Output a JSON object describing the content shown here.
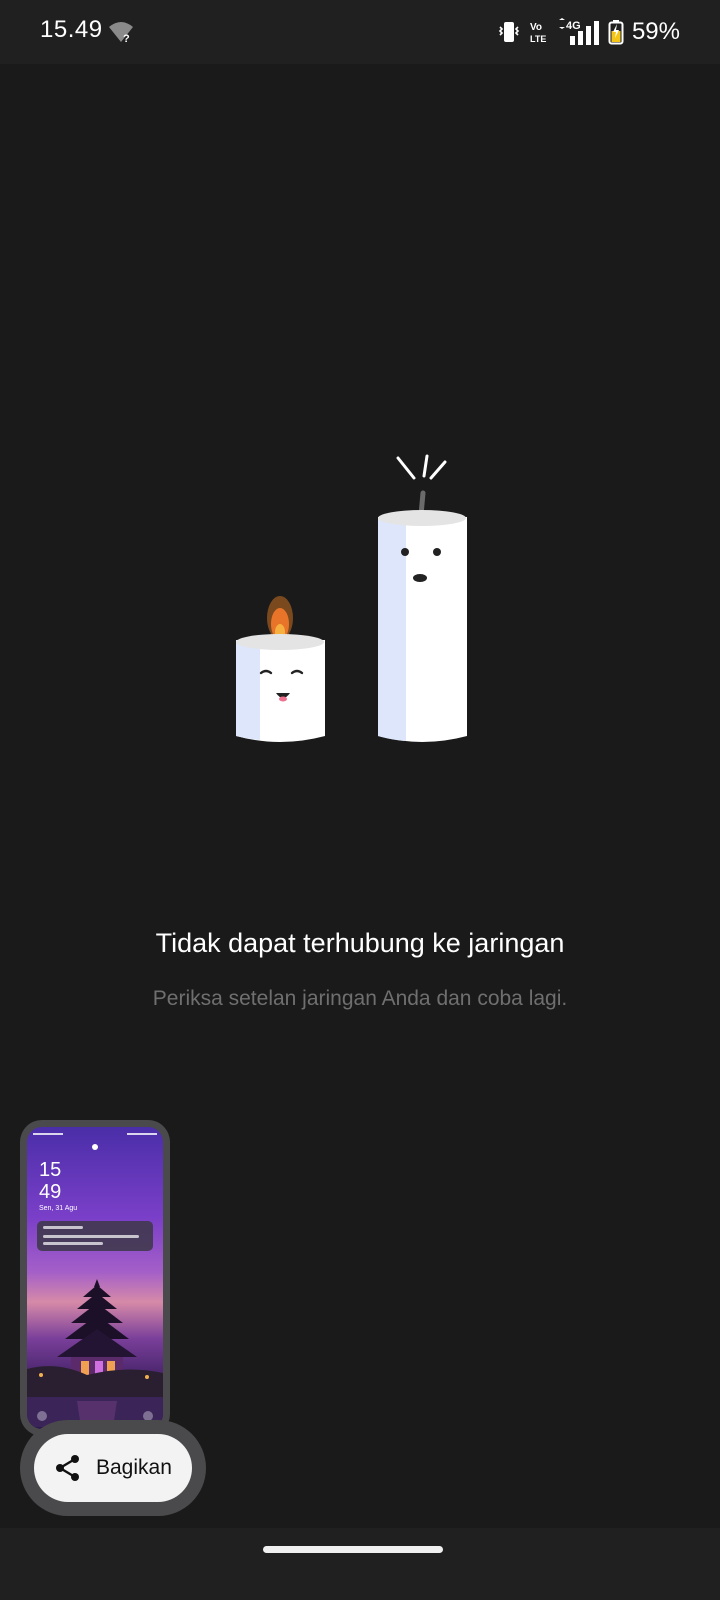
{
  "status_bar": {
    "time": "15.49",
    "network_type": "4G",
    "volte_line1": "Vo",
    "volte_line2": "LTE",
    "battery_percent": "59%",
    "icons": [
      "wifi-question-icon",
      "vibrate-icon",
      "volte-icon",
      "data-arrows-icon",
      "signal-icon",
      "battery-icon"
    ]
  },
  "illustration": {
    "name": "two-candles-illustration",
    "flame_color": "#e8742a",
    "candle_color": "#ffffff",
    "shadow_color": "#dde6fb"
  },
  "message": {
    "title": "Tidak dapat terhubung ke jaringan",
    "subtitle": "Periksa setelan jaringan Anda dan coba lagi."
  },
  "screenshot_preview": {
    "clock_hour": "15",
    "clock_minute": "49",
    "date": "Sen, 31 Agu"
  },
  "share": {
    "label": "Bagikan",
    "icon": "share-icon"
  },
  "colors": {
    "background": "#1b1a1b",
    "title": "#ffffff",
    "subtitle": "#6f6f6f",
    "button_bg": "#f3f3f3",
    "battery_fill": "#f5c518"
  }
}
